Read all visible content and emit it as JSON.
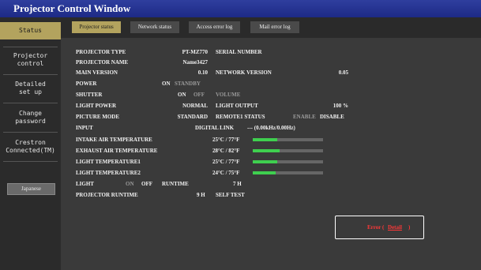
{
  "window": {
    "title": "Projector Control Window"
  },
  "sidebar": {
    "items": [
      {
        "label": "Status"
      },
      {
        "label": "Projector\ncontrol"
      },
      {
        "label": "Detailed\nset up"
      },
      {
        "label": "Change\npassword"
      },
      {
        "label": "Crestron\nConnected(TM)"
      }
    ],
    "language_button": "Japanese"
  },
  "tabs": [
    {
      "label": "Projector status"
    },
    {
      "label": "Network status"
    },
    {
      "label": "Access error log"
    },
    {
      "label": "Mail error log"
    }
  ],
  "status": {
    "projector_type": {
      "label": "PROJECTOR TYPE",
      "value": "PT-MZ770"
    },
    "serial_number": {
      "label": "SERIAL NUMBER",
      "value": ""
    },
    "projector_name": {
      "label": "PROJECTOR NAME",
      "value": "Name3427"
    },
    "main_version": {
      "label": "MAIN VERSION",
      "value": "0.10"
    },
    "network_version": {
      "label": "NETWORK VERSION",
      "value": "0.05"
    },
    "power": {
      "label": "POWER",
      "on": "ON",
      "standby": "STANDBY"
    },
    "shutter": {
      "label": "SHUTTER",
      "on": "ON",
      "off": "OFF"
    },
    "volume": {
      "label": "VOLUME"
    },
    "light_power": {
      "label": "LIGHT POWER",
      "value": "NORMAL"
    },
    "light_output": {
      "label": "LIGHT OUTPUT",
      "value": "100 %"
    },
    "picture_mode": {
      "label": "PICTURE MODE",
      "value": "STANDARD"
    },
    "remote1_status": {
      "label": "REMOTE1 STATUS",
      "enable": "ENABLE",
      "disable": "DISABLE"
    },
    "input": {
      "label": "INPUT",
      "value": "DIGITAL LINK",
      "signal": "--- (0.00kHz/0.00Hz)"
    },
    "intake_temp": {
      "label": "INTAKE AIR TEMPERATURE",
      "value": "25°C / 77°F",
      "level": 0.35
    },
    "exhaust_temp": {
      "label": "EXHAUST AIR TEMPERATURE",
      "value": "28°C / 82°F",
      "level": 0.38
    },
    "light_temp1": {
      "label": "LIGHT TEMPERATURE1",
      "value": "25°C / 77°F",
      "level": 0.35
    },
    "light_temp2": {
      "label": "LIGHT TEMPERATURE2",
      "value": "24°C / 75°F",
      "level": 0.33
    },
    "light": {
      "label": "LIGHT",
      "on": "ON",
      "off": "OFF",
      "runtime_label": "RUNTIME",
      "runtime": "7 H"
    },
    "projector_runtime": {
      "label": "PROJECTOR RUNTIME",
      "value": "9 H"
    },
    "self_test": {
      "label": "SELF TEST",
      "value": "Error (",
      "detail": "Detail",
      "close": ")"
    }
  },
  "colors": {
    "accent": "#b3a35e",
    "title_bar": "#1d2a86",
    "bar_fill": "#3fcf4f",
    "error": "#ff3838"
  }
}
